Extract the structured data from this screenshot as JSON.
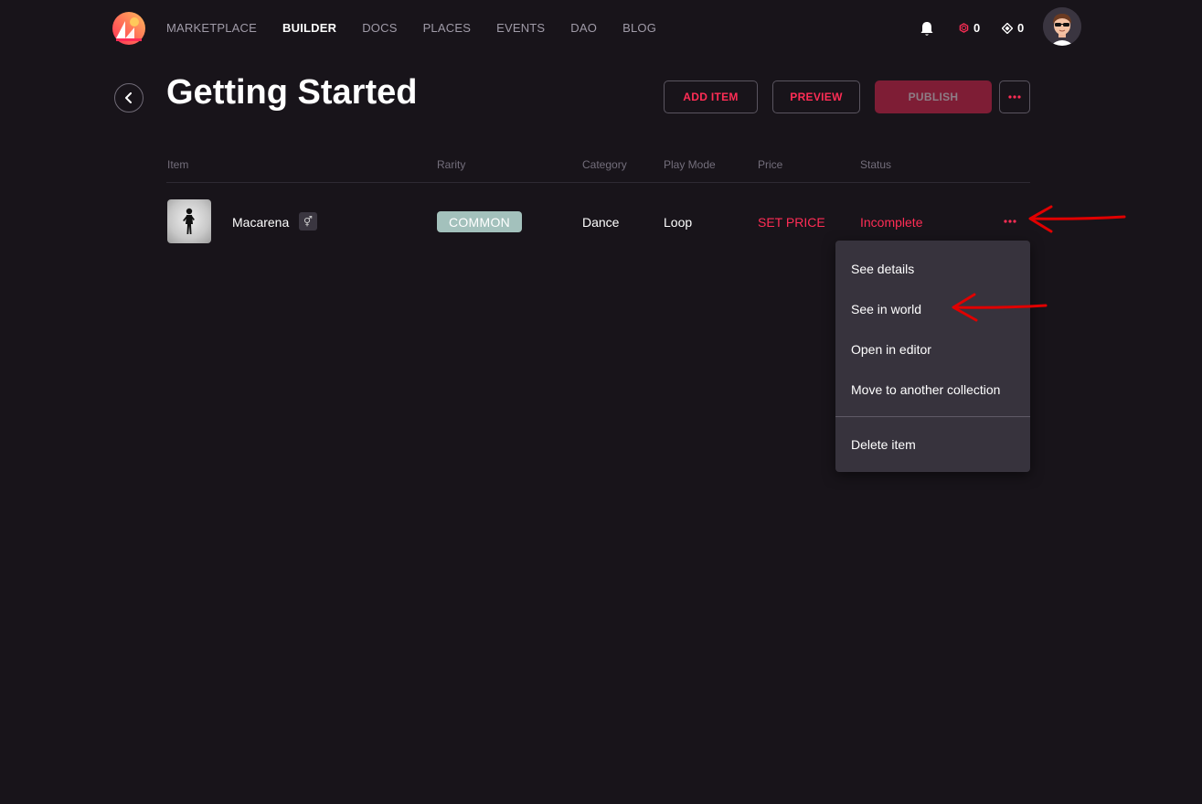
{
  "nav": {
    "links": [
      "MARKETPLACE",
      "BUILDER",
      "DOCS",
      "PLACES",
      "EVENTS",
      "DAO",
      "BLOG"
    ],
    "active": "BUILDER",
    "mana_polygon": "0",
    "mana_ethereum": "0"
  },
  "header": {
    "title": "Getting Started",
    "add_item_label": "ADD ITEM",
    "preview_label": "PREVIEW",
    "publish_label": "PUBLISH"
  },
  "table": {
    "headers": [
      "Item",
      "Rarity",
      "Category",
      "Play Mode",
      "Price",
      "Status"
    ],
    "row": {
      "name": "Macarena",
      "rarity": "COMMON",
      "category": "Dance",
      "play_mode": "Loop",
      "price": "SET PRICE",
      "status": "Incomplete"
    }
  },
  "menu": {
    "items": [
      "See details",
      "See in world",
      "Open in editor",
      "Move to another collection"
    ],
    "delete_label": "Delete item"
  },
  "colors": {
    "background": "#18141a",
    "accent": "#ff2d55",
    "publish_bg": "#7e1d35",
    "rarity_common": "#a3c1bc",
    "menu_bg": "#37333d",
    "annotation": "#e00000"
  }
}
